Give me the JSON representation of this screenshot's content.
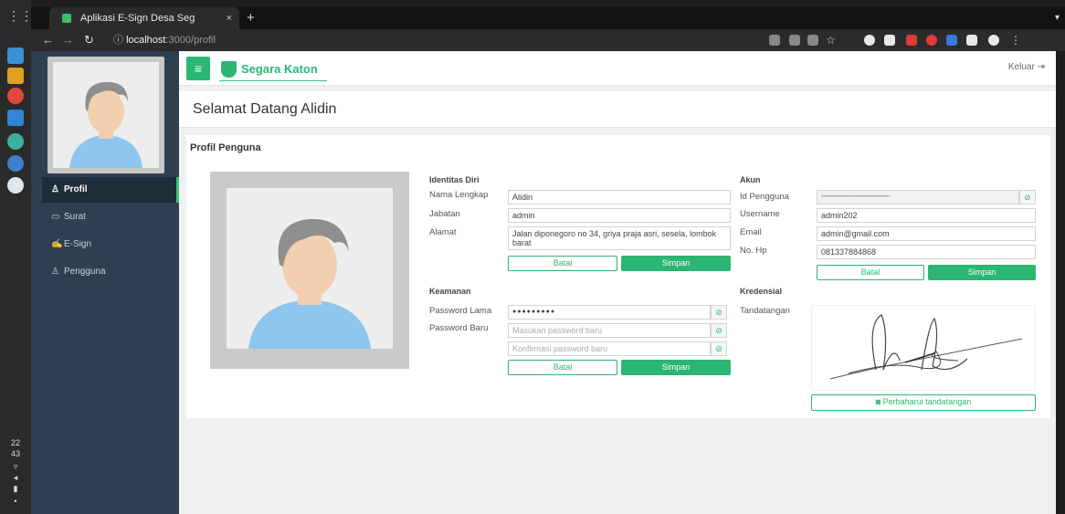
{
  "browser": {
    "tab_title": "Aplikasi E-Sign Desa Seg",
    "tab_close": "×",
    "new_tab": "+",
    "url_host": "localhost",
    "url_path": ":3000/profil"
  },
  "system": {
    "clock_hour": "22",
    "clock_min": "43"
  },
  "app": {
    "menu_icon": "≡",
    "brand": "Segara Katon",
    "logout": "Keluar"
  },
  "sidebar": {
    "items": [
      {
        "icon": "♙",
        "label": "Profil"
      },
      {
        "icon": "▭",
        "label": "Surat"
      },
      {
        "icon": "✍",
        "label": "E-Sign"
      },
      {
        "icon": "♙",
        "label": "Pengguna"
      }
    ]
  },
  "page": {
    "welcome": "Selamat Datang Alidin",
    "card_title": "Profil Penguna"
  },
  "identitas": {
    "title": "Identitas Diri",
    "nama_label": "Nama Lengkap",
    "nama_value": "Alidin",
    "jabatan_label": "Jabatan",
    "jabatan_value": "admin",
    "alamat_label": "Alamat",
    "alamat_value": "Jalan diponegoro no 34, griya praja asri, sesela, lombok barat",
    "batal": "Batal",
    "simpan": "Simpan"
  },
  "keamanan": {
    "title": "Keamanan",
    "lama_label": "Password Lama",
    "lama_value": "●●●●●●●●●",
    "baru_label": "Password Baru",
    "baru_placeholder": "Masukan password baru",
    "konfirmasi_placeholder": "Konfirmasi password baru",
    "batal": "Batal",
    "simpan": "Simpan"
  },
  "akun": {
    "title": "Akun",
    "id_label": "Id Pengguna",
    "id_value": "••••••••••••••••••••••••••••••••••••",
    "username_label": "Username",
    "username_value": "admin202",
    "email_label": "Email",
    "email_value": "admin@gmail.com",
    "hp_label": "No. Hp",
    "hp_value": "081337884868",
    "batal": "Batal",
    "simpan": "Simpan"
  },
  "kredensial": {
    "title": "Kredensial",
    "ttd_label": "Tandatangan",
    "update_button": "Perbaharui tandatangan"
  },
  "colors": {
    "accent": "#2bb673",
    "sidebar": "#2e3f52"
  }
}
